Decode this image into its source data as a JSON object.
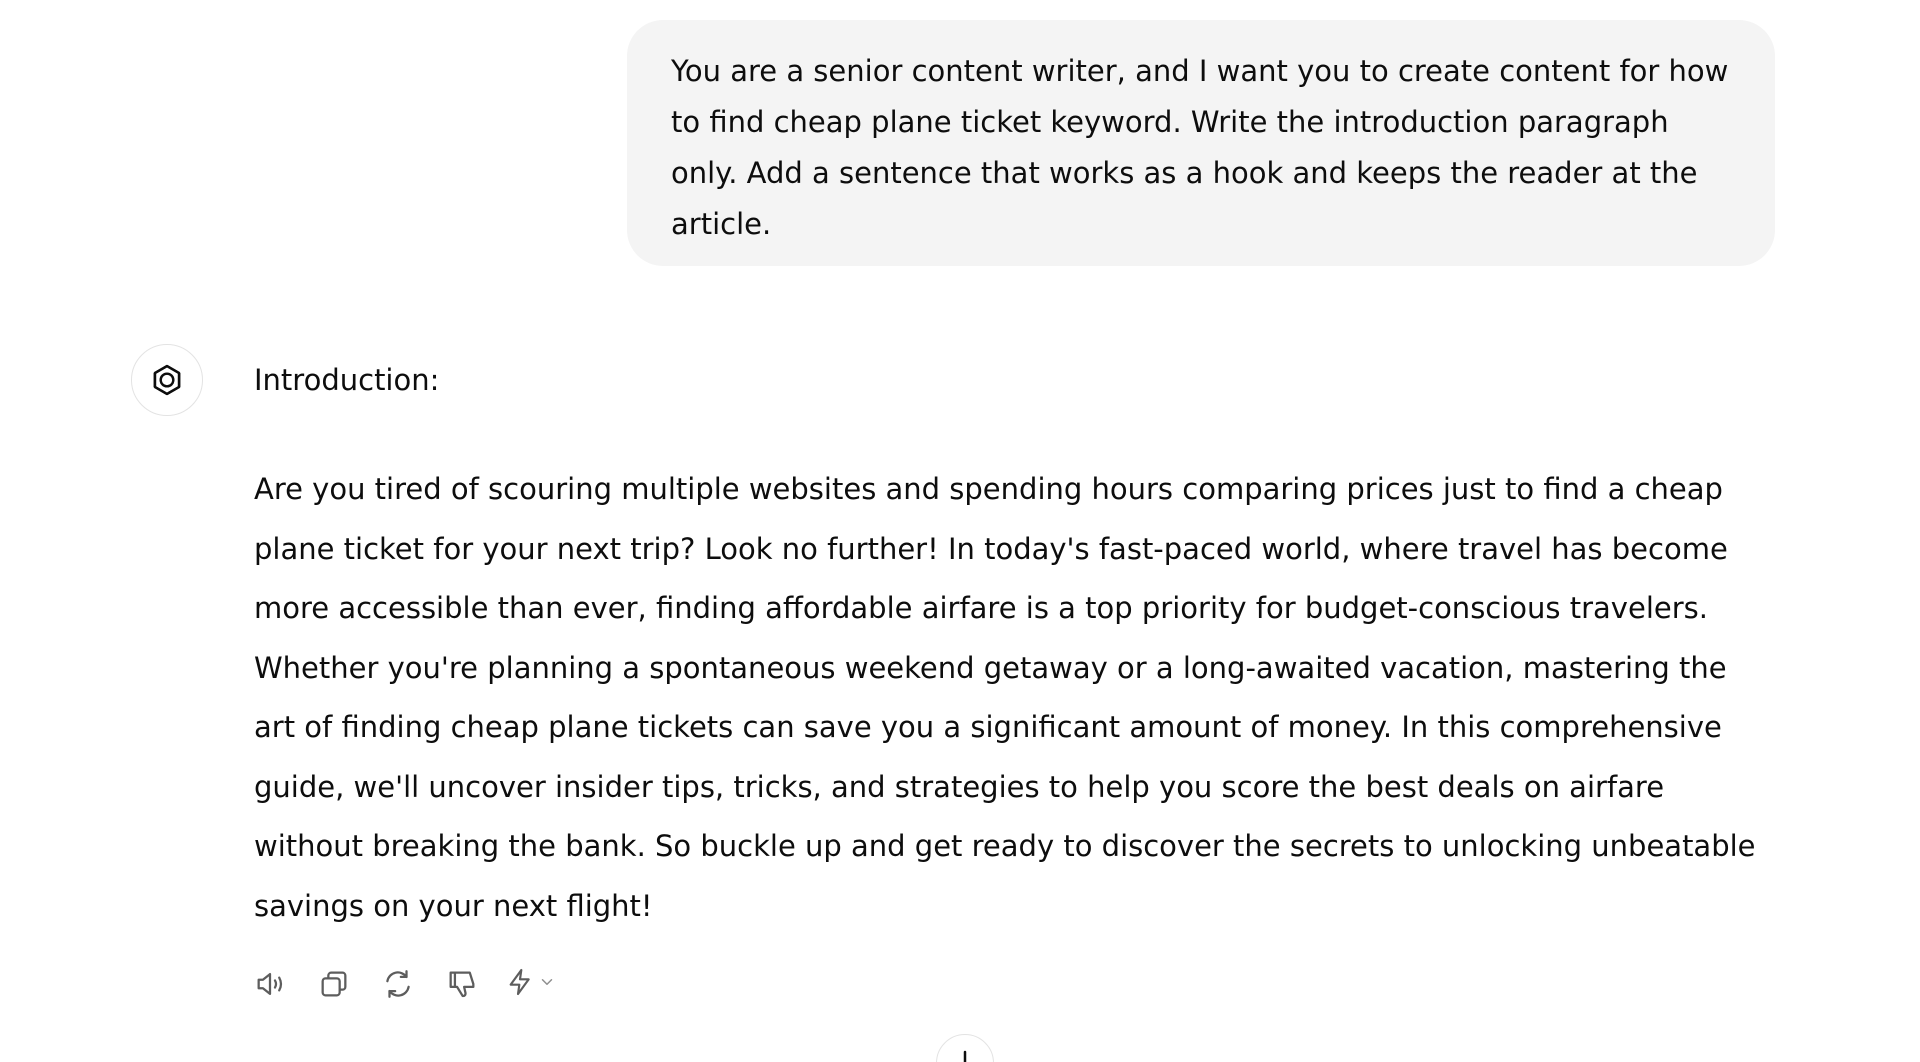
{
  "user_message": {
    "text": "You are a senior content writer, and I want you to create content for how to find cheap plane ticket keyword. Write the introduction paragraph only. Add a sentence that works as a hook and keeps the reader at the article."
  },
  "assistant_message": {
    "avatar_icon": "openai-logo-icon",
    "heading": "Introduction:",
    "body": "Are you tired of scouring multiple websites and spending hours comparing prices just to find a cheap plane ticket for your next trip? Look no further! In today's fast-paced world, where travel has become more accessible than ever, finding affordable airfare is a top priority for budget-conscious travelers. Whether you're planning a spontaneous weekend getaway or a long-awaited vacation, mastering the art of finding cheap plane tickets can save you a significant amount of money. In this comprehensive guide, we'll uncover insider tips, tricks, and strategies to help you score the best deals on airfare without breaking the bank. So buckle up and get ready to discover the secrets to unlocking unbeatable savings on your next flight!"
  },
  "actions": {
    "icons": [
      "speaker-icon",
      "copy-icon",
      "regenerate-icon",
      "thumbs-down-icon",
      "bolt-icon",
      "chevron-down-icon"
    ]
  },
  "scroll_button": {
    "icon": "arrow-down-icon"
  },
  "colors": {
    "bubble_bg": "#f4f4f4",
    "text": "#0d0d0d",
    "icon": "#5d5d5d"
  }
}
